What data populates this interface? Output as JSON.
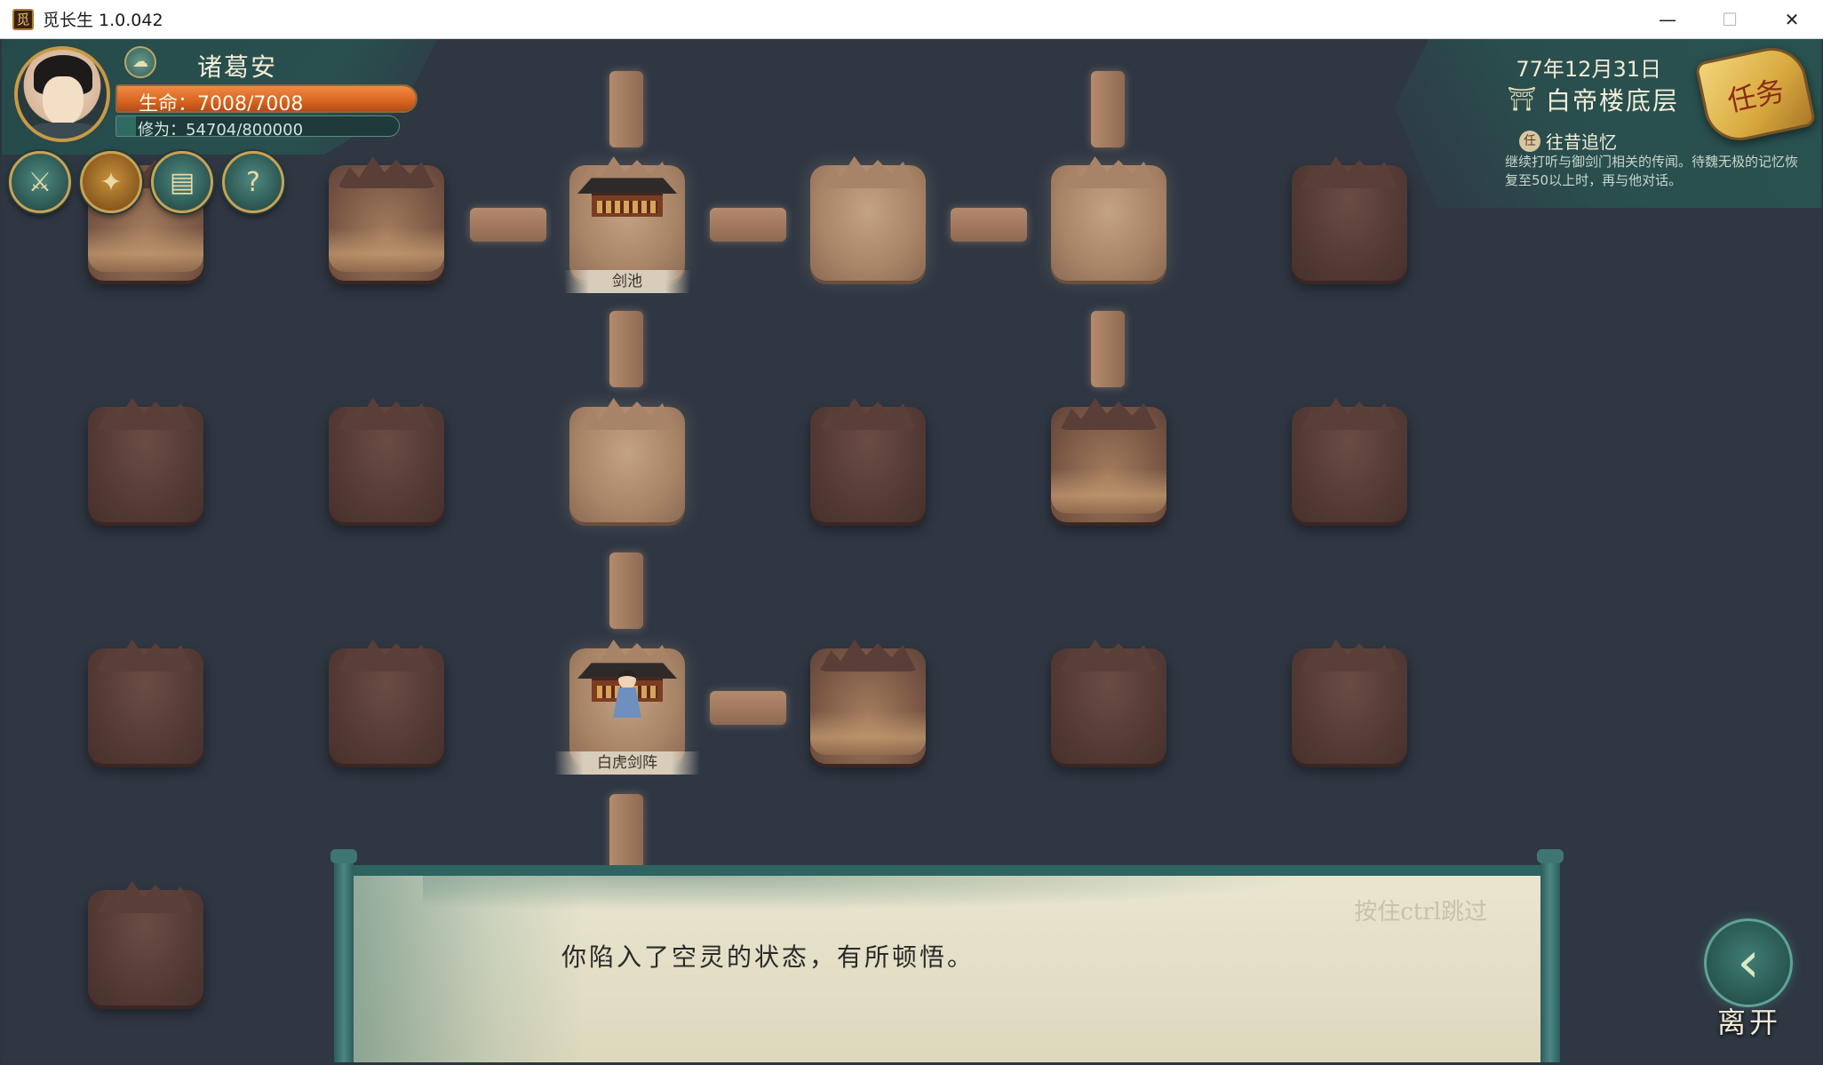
{
  "window": {
    "title": "觅长生 1.0.042",
    "app_icon_glyph": "觅",
    "minimize_glyph": "—",
    "maximize_glyph": "☐",
    "close_glyph": "✕"
  },
  "player": {
    "name": "诸葛安",
    "hp_text": "生命：7008/7008",
    "hp_fraction": 1.0,
    "cultivation_text": "修为：54704/800000",
    "cultivation_fraction": 0.0684,
    "badge_icon": "chat-bubble-icon",
    "skills": [
      {
        "name": "sword-skill-icon",
        "glyph": "⚔"
      },
      {
        "name": "gourd-item-icon",
        "glyph": "✦"
      },
      {
        "name": "scroll-map-icon",
        "glyph": "▤"
      },
      {
        "name": "quest-book-icon",
        "glyph": "?"
      }
    ]
  },
  "status": {
    "date": "77年12月31日",
    "location": "白帝楼底层",
    "location_icon": "gate-icon",
    "quest_button_label": "任务"
  },
  "quest": {
    "tag": "任",
    "title": "往昔追忆",
    "description": "继续打听与御剑门相关的传闻。待魏无极的记忆恢复至50以上时，再与他对话。"
  },
  "map": {
    "labels": {
      "sword_pool": "剑池",
      "white_tiger_array": "白虎剑阵"
    }
  },
  "dialog": {
    "skip_hint": "按住ctrl跳过",
    "text": "你陷入了空灵的状态，有所顿悟。"
  },
  "leave": {
    "label": "离开",
    "icon": "back-arrow-icon"
  }
}
